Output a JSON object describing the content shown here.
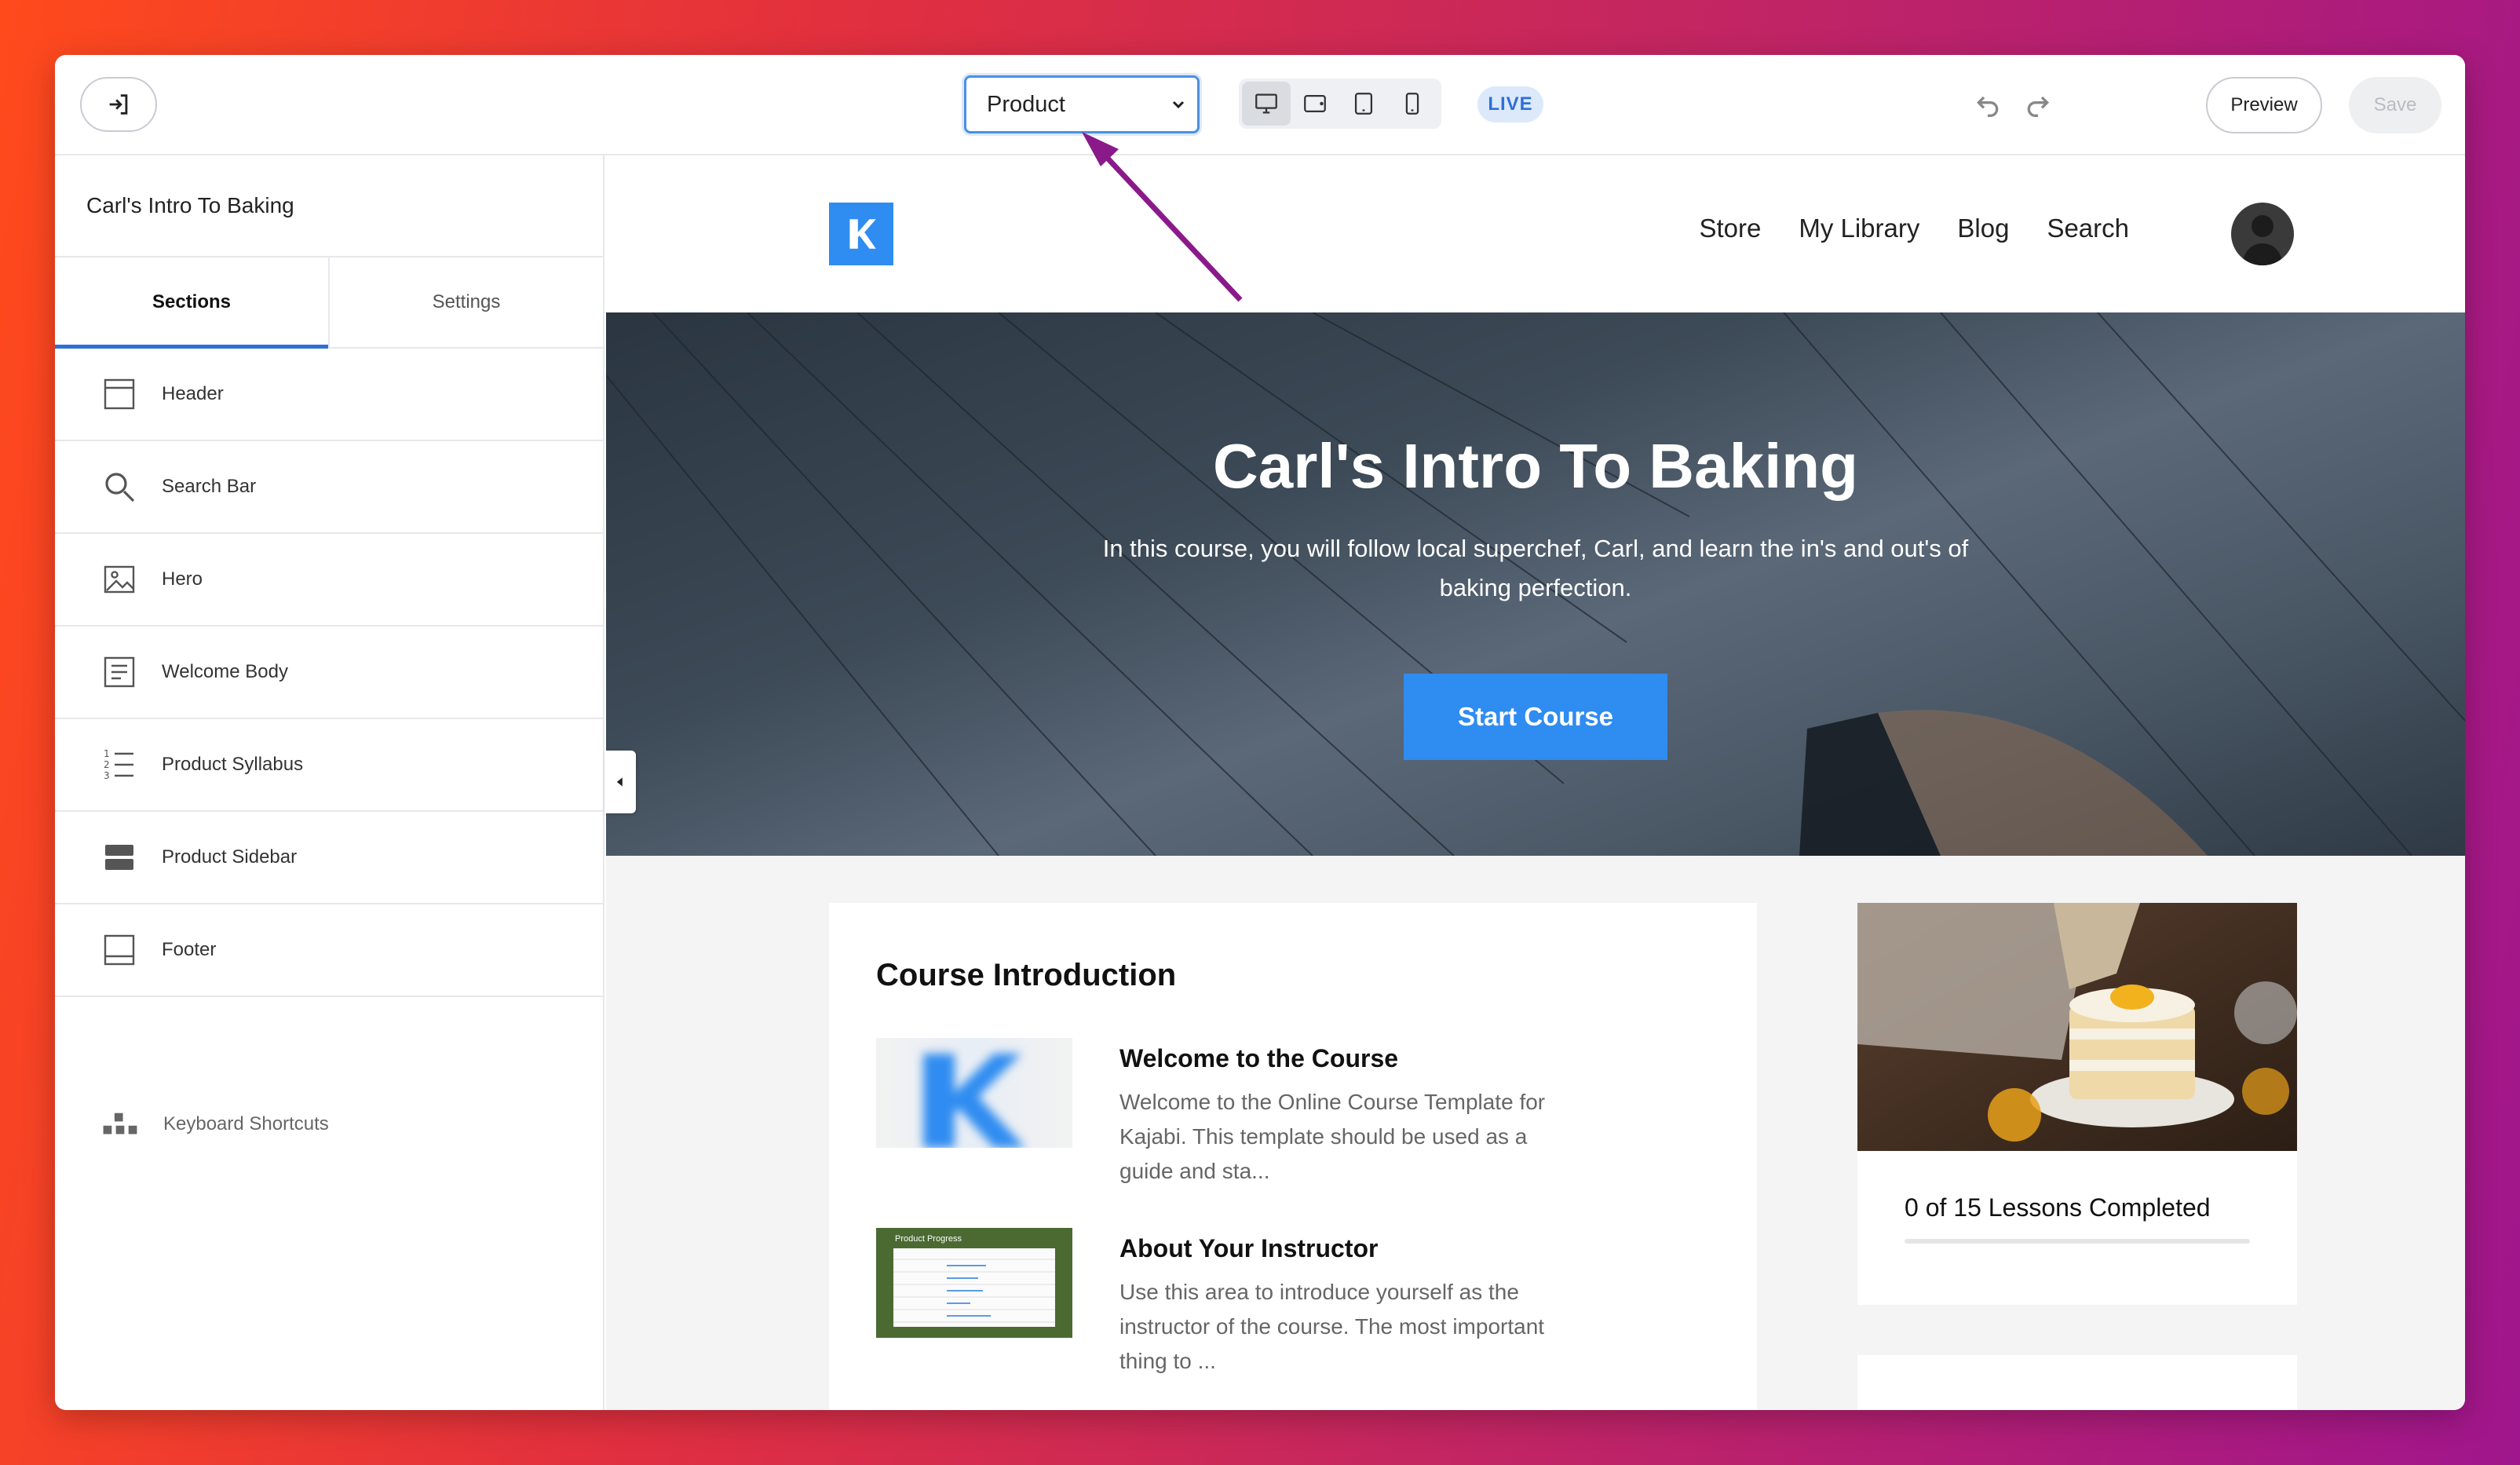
{
  "toolbar": {
    "page_select_value": "Product",
    "live_label": "LIVE",
    "preview_label": "Preview",
    "save_label": "Save",
    "devices": [
      "desktop-icon",
      "tablet-landscape-icon",
      "tablet-portrait-icon",
      "mobile-icon"
    ]
  },
  "sidebar": {
    "title": "Carl's Intro To Baking",
    "tabs": [
      {
        "label": "Sections"
      },
      {
        "label": "Settings"
      }
    ],
    "items": [
      {
        "label": "Header",
        "icon": "header-icon"
      },
      {
        "label": "Search Bar",
        "icon": "search-icon"
      },
      {
        "label": "Hero",
        "icon": "image-icon"
      },
      {
        "label": "Welcome Body",
        "icon": "text-block-icon"
      },
      {
        "label": "Product Syllabus",
        "icon": "numbered-list-icon"
      },
      {
        "label": "Product Sidebar",
        "icon": "sidebar-layout-icon"
      },
      {
        "label": "Footer",
        "icon": "footer-icon"
      }
    ],
    "shortcuts_label": "Keyboard Shortcuts"
  },
  "site": {
    "nav": [
      "Store",
      "My Library",
      "Blog",
      "Search"
    ],
    "hero": {
      "title": "Carl's Intro To Baking",
      "subtitle": "In this course, you will follow local superchef, Carl, and learn the in's and out's of baking perfection.",
      "cta": "Start Course"
    },
    "course": {
      "title": "Course Introduction",
      "lessons": [
        {
          "title": "Welcome to the Course",
          "desc": "Welcome to the Online Course Template for Kajabi. This template should be used as a guide and sta..."
        },
        {
          "title": "About Your Instructor",
          "desc": "Use this area to introduce yourself as the instructor of the course. The most important thing to ..."
        }
      ],
      "thumb2_label": "Product Progress"
    },
    "progress": {
      "label": "0 of 15 Lessons Completed",
      "fraction": 0
    },
    "accent_color": "#2f8cf0"
  }
}
